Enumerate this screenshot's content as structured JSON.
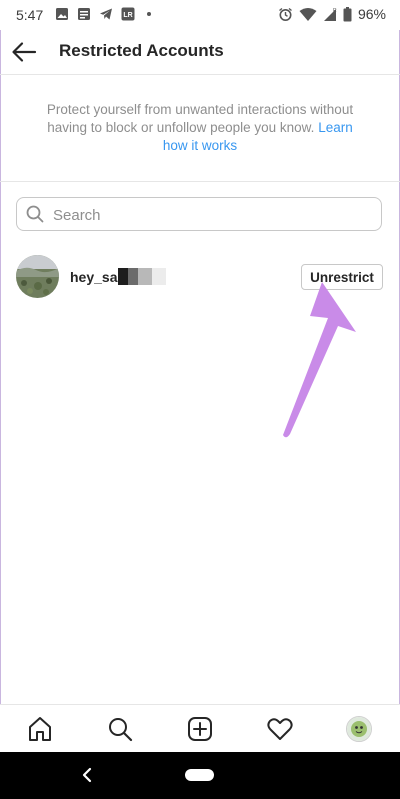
{
  "status_bar": {
    "time": "5:47",
    "battery": "96%",
    "left_icons": [
      "image-icon",
      "news-icon",
      "telegram-icon",
      "lr-app-icon",
      "dot-icon"
    ],
    "right_icons": [
      "alarm-icon",
      "wifi-icon",
      "signal-icon",
      "battery-icon"
    ]
  },
  "header": {
    "title": "Restricted Accounts",
    "back_icon": "back-arrow-icon"
  },
  "description": {
    "text": "Protect yourself from unwanted interactions without having to block or unfollow people you know.",
    "link": "Learn how it works",
    "link_color": "#3897f0"
  },
  "search": {
    "placeholder": "Search",
    "value": ""
  },
  "accounts": [
    {
      "username": "hey_sar",
      "action": "Unrestrict"
    }
  ],
  "annotation": {
    "color": "#c98be8",
    "icon": "pointer-arrow"
  },
  "tab_bar": {
    "tabs": [
      "home-icon",
      "search-icon",
      "new-post-icon",
      "activity-heart-icon",
      "profile-avatar"
    ]
  },
  "system_nav": [
    "back-chevron",
    "home-pill"
  ]
}
